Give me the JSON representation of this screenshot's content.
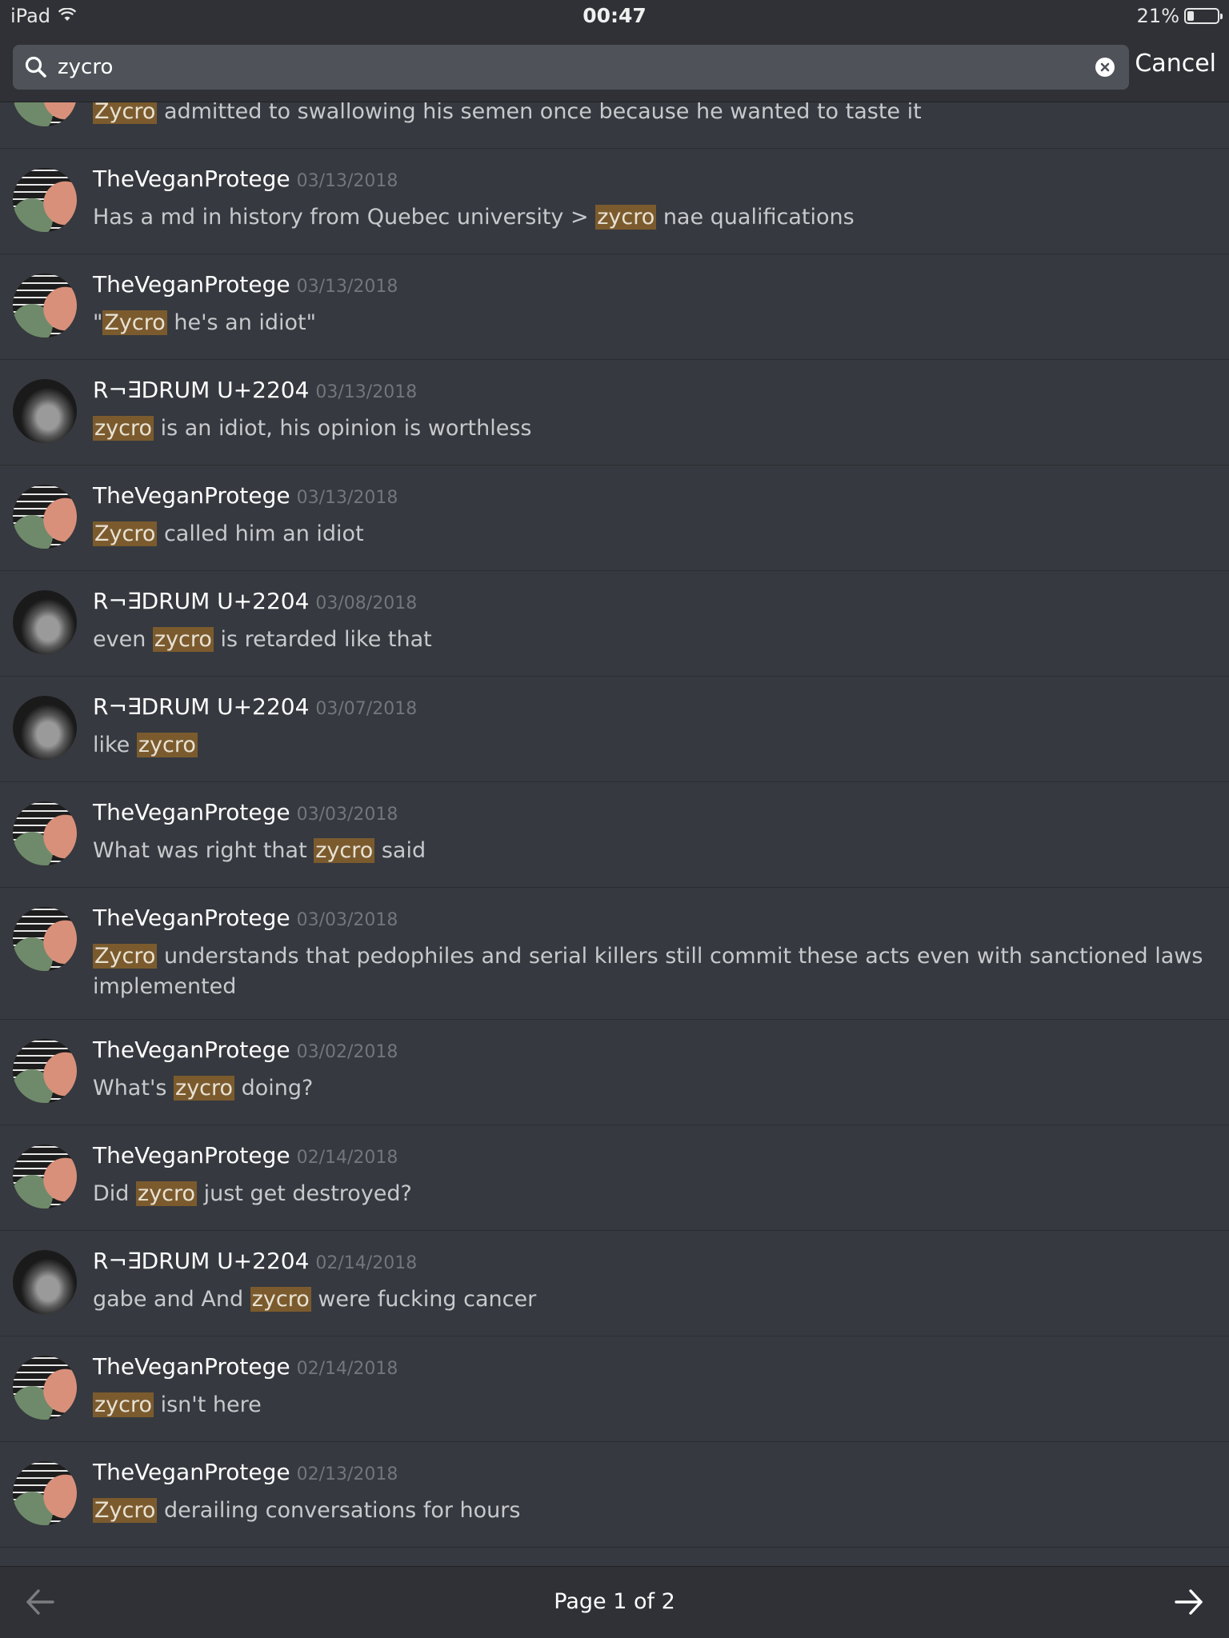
{
  "status_bar": {
    "device": "iPad",
    "time": "00:47",
    "battery": "21%",
    "battery_level": 0.21,
    "icons": [
      "wifi-icon",
      "battery-icon"
    ]
  },
  "search": {
    "query": "zycro",
    "cancel_label": "Cancel",
    "icons": [
      "search-icon",
      "clear-icon"
    ]
  },
  "results": [
    {
      "author": "",
      "date": "",
      "avatar": "vegan",
      "segments": [
        {
          "t": "Zycro",
          "h": true
        },
        {
          "t": " admitted to swallowing his semen once because he wanted to taste it",
          "h": false
        }
      ]
    },
    {
      "author": "TheVeganProtege",
      "date": "03/13/2018",
      "avatar": "vegan",
      "segments": [
        {
          "t": "Has a md in history from Quebec university > ",
          "h": false
        },
        {
          "t": "zycro",
          "h": true
        },
        {
          "t": " nae qualifications",
          "h": false
        }
      ]
    },
    {
      "author": "TheVeganProtege",
      "date": "03/13/2018",
      "avatar": "vegan",
      "segments": [
        {
          "t": "\"",
          "h": false
        },
        {
          "t": "Zycro",
          "h": true
        },
        {
          "t": " he's an idiot\"",
          "h": false
        }
      ]
    },
    {
      "author": "R¬∃DRUM U+2204",
      "date": "03/13/2018",
      "avatar": "rdrum",
      "segments": [
        {
          "t": "zycro",
          "h": true
        },
        {
          "t": " is an idiot, his opinion is worthless",
          "h": false
        }
      ]
    },
    {
      "author": "TheVeganProtege",
      "date": "03/13/2018",
      "avatar": "vegan",
      "segments": [
        {
          "t": "Zycro",
          "h": true
        },
        {
          "t": " called him an idiot",
          "h": false
        }
      ]
    },
    {
      "author": "R¬∃DRUM U+2204",
      "date": "03/08/2018",
      "avatar": "rdrum",
      "segments": [
        {
          "t": "even ",
          "h": false
        },
        {
          "t": "zycro",
          "h": true
        },
        {
          "t": " is retarded like that",
          "h": false
        }
      ]
    },
    {
      "author": "R¬∃DRUM U+2204",
      "date": "03/07/2018",
      "avatar": "rdrum",
      "segments": [
        {
          "t": "like ",
          "h": false
        },
        {
          "t": "zycro",
          "h": true
        }
      ]
    },
    {
      "author": "TheVeganProtege",
      "date": "03/03/2018",
      "avatar": "vegan",
      "segments": [
        {
          "t": "What was right that ",
          "h": false
        },
        {
          "t": "zycro",
          "h": true
        },
        {
          "t": " said",
          "h": false
        }
      ]
    },
    {
      "author": "TheVeganProtege",
      "date": "03/03/2018",
      "avatar": "vegan",
      "segments": [
        {
          "t": "Zycro",
          "h": true
        },
        {
          "t": " understands that pedophiles and serial killers still commit these acts even with sanctioned laws implemented",
          "h": false
        }
      ]
    },
    {
      "author": "TheVeganProtege",
      "date": "03/02/2018",
      "avatar": "vegan",
      "segments": [
        {
          "t": "What's ",
          "h": false
        },
        {
          "t": "zycro",
          "h": true
        },
        {
          "t": " doing?",
          "h": false
        }
      ]
    },
    {
      "author": "TheVeganProtege",
      "date": "02/14/2018",
      "avatar": "vegan",
      "segments": [
        {
          "t": "Did ",
          "h": false
        },
        {
          "t": "zycro",
          "h": true
        },
        {
          "t": " just get destroyed?",
          "h": false
        }
      ]
    },
    {
      "author": "R¬∃DRUM U+2204",
      "date": "02/14/2018",
      "avatar": "rdrum",
      "segments": [
        {
          "t": "gabe and And ",
          "h": false
        },
        {
          "t": "zycro",
          "h": true
        },
        {
          "t": " were fucking cancer",
          "h": false
        }
      ]
    },
    {
      "author": "TheVeganProtege",
      "date": "02/14/2018",
      "avatar": "vegan",
      "segments": [
        {
          "t": "zycro",
          "h": true
        },
        {
          "t": " isn't here",
          "h": false
        }
      ]
    },
    {
      "author": "TheVeganProtege",
      "date": "02/13/2018",
      "avatar": "vegan",
      "segments": [
        {
          "t": "Zycro",
          "h": true
        },
        {
          "t": " derailing conversations for hours",
          "h": false
        }
      ]
    }
  ],
  "pagination": {
    "label": "Page 1 of 2",
    "icons": [
      "arrow-left-icon",
      "arrow-right-icon"
    ]
  },
  "colors": {
    "background": "#36393f",
    "header": "#2f3136",
    "highlight": "#7b5b2e",
    "date_text": "#72767d"
  }
}
